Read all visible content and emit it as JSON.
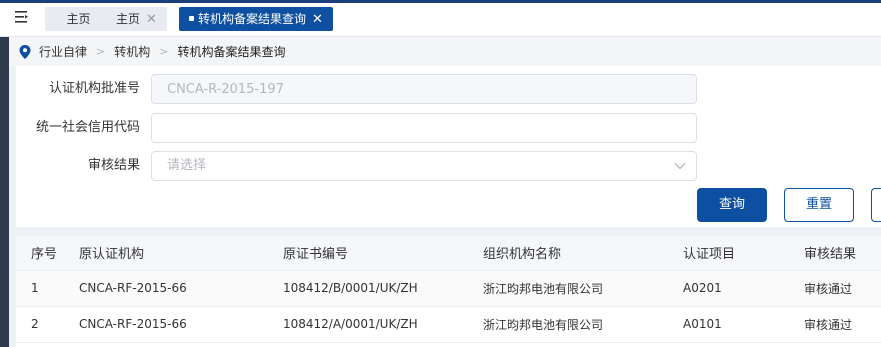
{
  "tabs": [
    {
      "label": "主页",
      "closable": false,
      "active": false
    },
    {
      "label": "主页",
      "closable": true,
      "active": false
    },
    {
      "label": "转机构备案结果查询",
      "closable": true,
      "active": true
    }
  ],
  "breadcrumb": [
    "行业自律",
    "转机构",
    "转机构备案结果查询"
  ],
  "form": {
    "approval_no_label": "认证机构批准号",
    "approval_no_value": "CNCA-R-2015-197",
    "credit_code_label": "统一社会信用代码",
    "credit_code_value": "",
    "review_result_label": "审核结果",
    "review_result_placeholder": "请选择"
  },
  "buttons": {
    "query": "查询",
    "reset": "重置"
  },
  "table": {
    "headers": [
      "序号",
      "原认证机构",
      "原证书编号",
      "组织机构名称",
      "认证项目",
      "审核结果"
    ],
    "rows": [
      [
        "1",
        "CNCA-RF-2015-66",
        "108412/B/0001/UK/ZH",
        "浙江昀邦电池有限公司",
        "A0201",
        "审核通过"
      ],
      [
        "2",
        "CNCA-RF-2015-66",
        "108412/A/0001/UK/ZH",
        "浙江昀邦电池有限公司",
        "A0101",
        "审核通过"
      ]
    ]
  },
  "colors": {
    "primary": "#0d4fa0",
    "sidebar": "#2d3a4b"
  }
}
